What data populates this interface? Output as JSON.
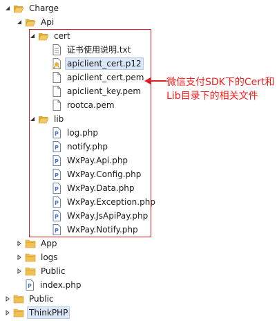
{
  "tree": [
    {
      "label": "Charge",
      "type": "folder",
      "state": "open",
      "depth": 0
    },
    {
      "label": "Api",
      "type": "folder",
      "state": "open",
      "depth": 1
    },
    {
      "label": "cert",
      "type": "folder",
      "state": "open",
      "depth": 2
    },
    {
      "label": "证书使用说明.txt",
      "type": "txt",
      "depth": 3
    },
    {
      "label": "apiclient_cert.p12",
      "type": "p12",
      "depth": 3,
      "selected": true
    },
    {
      "label": "apiclient_cert.pem",
      "type": "file",
      "depth": 3
    },
    {
      "label": "apiclient_key.pem",
      "type": "file",
      "depth": 3
    },
    {
      "label": "rootca.pem",
      "type": "file",
      "depth": 3
    },
    {
      "label": "lib",
      "type": "folder",
      "state": "open",
      "depth": 2
    },
    {
      "label": "log.php",
      "type": "php",
      "depth": 3
    },
    {
      "label": "notify.php",
      "type": "php",
      "depth": 3
    },
    {
      "label": "WxPay.Api.php",
      "type": "php",
      "depth": 3
    },
    {
      "label": "WxPay.Config.php",
      "type": "php",
      "depth": 3
    },
    {
      "label": "WxPay.Data.php",
      "type": "php",
      "depth": 3
    },
    {
      "label": "WxPay.Exception.php",
      "type": "php",
      "depth": 3
    },
    {
      "label": "WxPay.JsApiPay.php",
      "type": "php",
      "depth": 3
    },
    {
      "label": "WxPay.Notify.php",
      "type": "php",
      "depth": 3
    },
    {
      "label": "App",
      "type": "folder",
      "state": "closed",
      "depth": 1
    },
    {
      "label": "logs",
      "type": "folder",
      "state": "closed",
      "depth": 1
    },
    {
      "label": "Public",
      "type": "folder",
      "state": "closed",
      "depth": 1
    },
    {
      "label": "index.php",
      "type": "php",
      "depth": 1
    },
    {
      "label": "Public",
      "type": "folder",
      "state": "closed",
      "depth": 0
    },
    {
      "label": "ThinkPHP",
      "type": "folder",
      "state": "closed",
      "depth": 0,
      "selected": true
    }
  ],
  "annotation": {
    "text": "微信支付SDK下的Cert和Lib目录下的相关文件",
    "color": "#ff1a1a"
  },
  "colors": {
    "folder": "#e8b94a",
    "php_file": "#4a6fb5",
    "highlight_box": "#e02020"
  }
}
